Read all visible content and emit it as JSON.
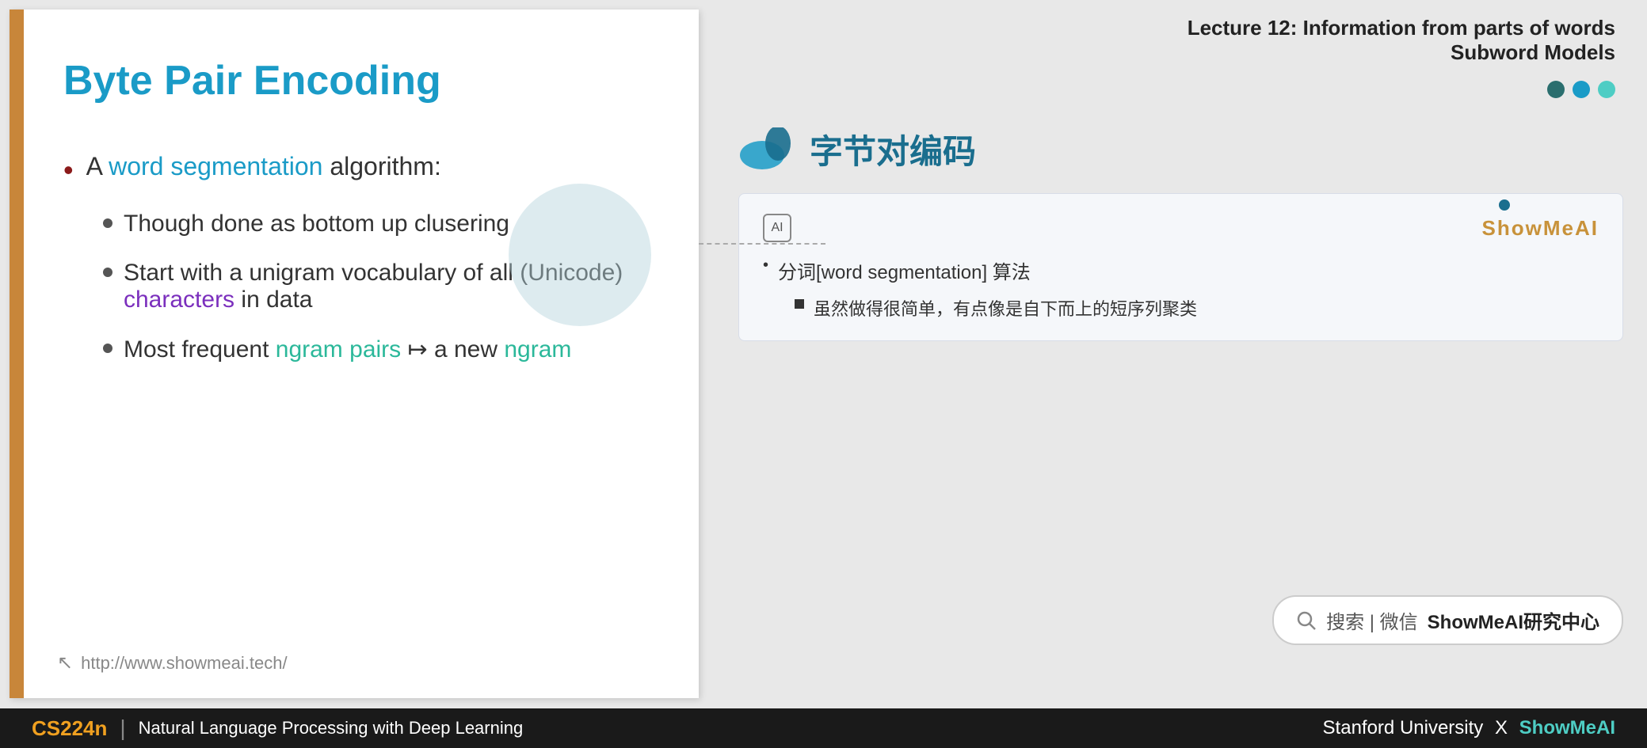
{
  "slide": {
    "title": "Byte Pair Encoding",
    "bullet1_prefix": "A ",
    "bullet1_highlight": "word segmentation",
    "bullet1_suffix": " algorithm:",
    "sub_bullet1": "Though done as bottom up clusering",
    "sub_bullet2_prefix": "Start with a unigram vocabulary of all (Unicode) ",
    "sub_bullet2_highlight": "characters",
    "sub_bullet2_suffix": " in data",
    "sub_bullet3_prefix": "Most frequent ",
    "sub_bullet3_ngram1": "ngram pairs",
    "sub_bullet3_mid": " ↦ a new ",
    "sub_bullet3_ngram2": "ngram",
    "footer_url": "http://www.showmeai.tech/"
  },
  "right_panel": {
    "lecture_line1": "Lecture 12: Information from parts of words",
    "lecture_line2": "Subword Models",
    "chinese_title": "字节对编码",
    "ai_icon": "AI",
    "brand": "ShowMeAI",
    "trans_bullet1": "分词[word segmentation] 算法",
    "trans_bullet2": "虽然做得很简单，有点像是自下而上的短序列聚类",
    "search_text": "搜索 | 微信",
    "search_bold": "ShowMeAI研究中心"
  },
  "bottom_bar": {
    "course": "CS224n",
    "divider": "|",
    "description": "Natural Language Processing with Deep Learning",
    "right_text1": "Stanford University",
    "separator": "X",
    "right_brand": "ShowMeAI"
  },
  "dots": [
    {
      "color": "#2a6e6e",
      "size": 22
    },
    {
      "color": "#1a9bc7",
      "size": 22
    },
    {
      "color": "#4ecdc4",
      "size": 22
    }
  ]
}
